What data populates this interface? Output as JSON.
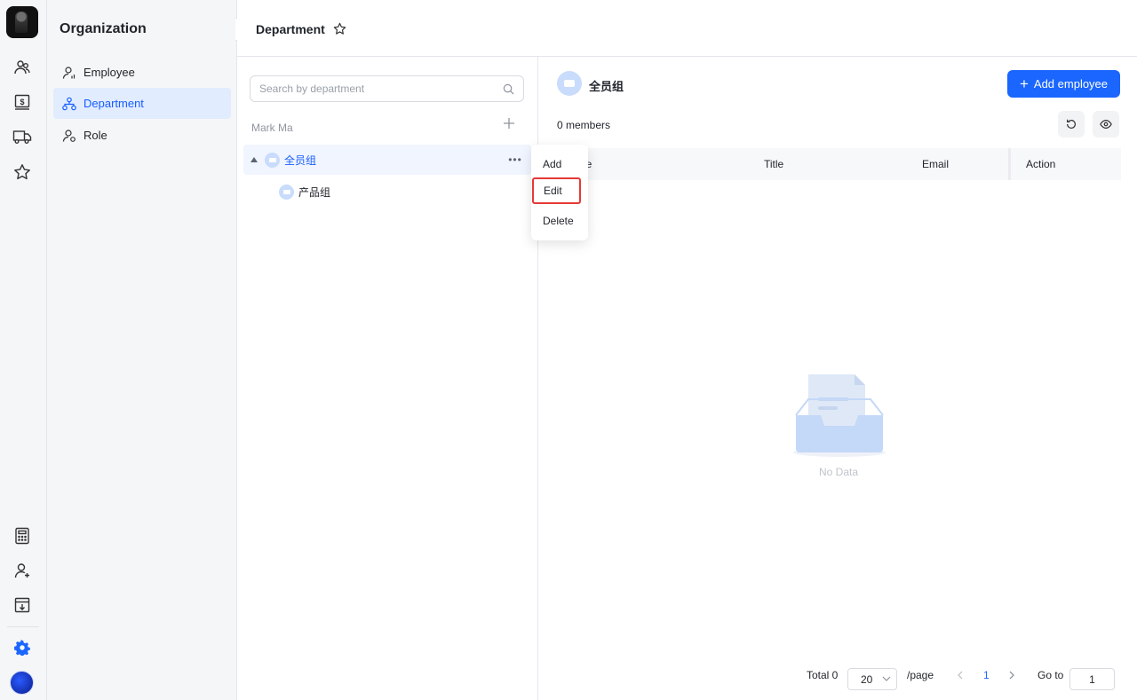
{
  "rail": {
    "icons": [
      "people-icon",
      "dollar-icon",
      "truck-icon",
      "star-icon",
      "calculator-icon",
      "user-icon",
      "download-icon",
      "settings-icon"
    ]
  },
  "subnav": {
    "title": "Organization",
    "items": [
      {
        "label": "Employee",
        "icon": "user-icon"
      },
      {
        "label": "Department",
        "icon": "org-icon",
        "active": true
      },
      {
        "label": "Role",
        "icon": "role-icon"
      }
    ]
  },
  "header": {
    "title": "Department"
  },
  "tree": {
    "search_placeholder": "Search by department",
    "owner": "Mark Ma",
    "root": {
      "label": "全员组"
    },
    "child": {
      "label": "产品组"
    }
  },
  "context_menu": {
    "items": [
      "Add",
      "Edit",
      "Delete"
    ],
    "highlighted": "Edit"
  },
  "members": {
    "department_name": "全员组",
    "add_button": "Add employee",
    "count_text": "0 members",
    "columns": [
      "ne",
      "Title",
      "Email",
      "Action"
    ],
    "empty_text": "No Data"
  },
  "pagination": {
    "total_text": "Total 0",
    "page_size": "20",
    "per_page_label": "/page",
    "current_page": "1",
    "goto_label": "Go to",
    "goto_value": "1"
  },
  "colors": {
    "accent": "#1a66ff",
    "highlight_border": "#e53935"
  }
}
